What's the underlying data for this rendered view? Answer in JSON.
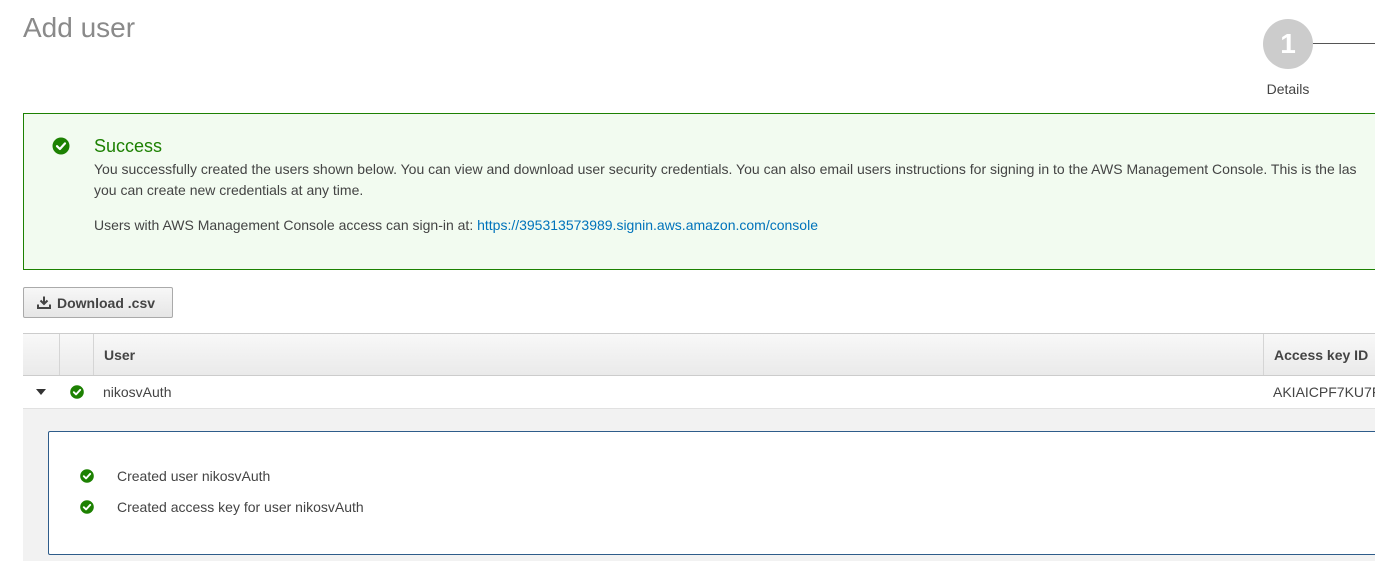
{
  "page": {
    "title": "Add user"
  },
  "stepper": {
    "step_number": "1",
    "step_label": "Details"
  },
  "alert": {
    "title": "Success",
    "line1": "You successfully created the users shown below. You can view and download user security credentials. You can also email users instructions for signing in to the AWS Management Console. This is the las",
    "line2": "you can create new credentials at any time.",
    "signin_prefix": "Users with AWS Management Console access can sign-in at: ",
    "signin_url": "https://395313573989.signin.aws.amazon.com/console",
    "icon": "check-circle-icon",
    "color": "#1d8102"
  },
  "toolbar": {
    "download_label": "Download .csv",
    "download_icon": "download-icon"
  },
  "table": {
    "columns": [
      "User",
      "Access key ID"
    ],
    "rows": [
      {
        "user": "nikosvAuth",
        "access_key_id": "AKIAICPF7KU7F",
        "status_icon": "check-circle-icon"
      }
    ]
  },
  "details": {
    "items": [
      "Created user nikosvAuth",
      "Created access key for user nikosvAuth"
    ]
  },
  "colors": {
    "success": "#1d8102",
    "link": "#0073bb",
    "detail_border": "#2e5c8a"
  }
}
